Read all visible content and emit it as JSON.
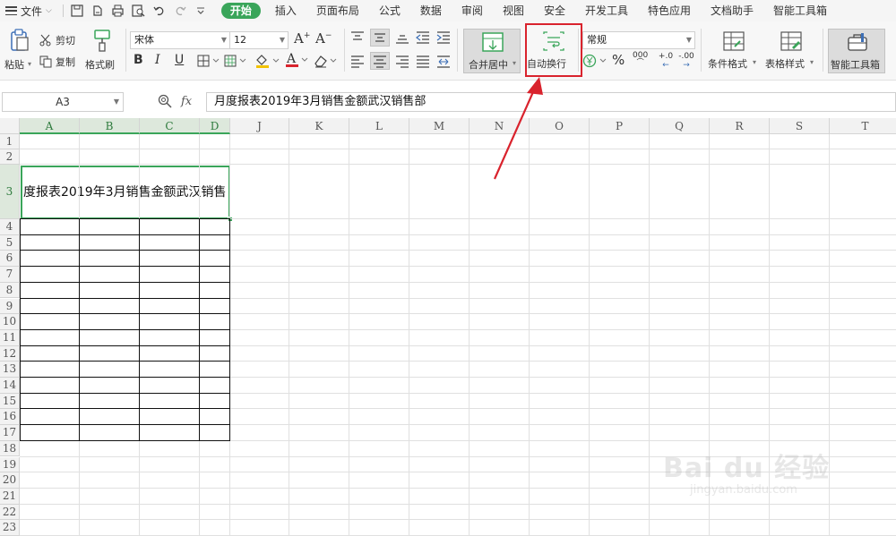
{
  "menubar": {
    "file_label": "文件",
    "tabs": [
      {
        "label": "开始",
        "active": true
      },
      {
        "label": "插入"
      },
      {
        "label": "页面布局"
      },
      {
        "label": "公式"
      },
      {
        "label": "数据"
      },
      {
        "label": "审阅"
      },
      {
        "label": "视图"
      },
      {
        "label": "安全"
      },
      {
        "label": "开发工具"
      },
      {
        "label": "特色应用"
      },
      {
        "label": "文档助手"
      },
      {
        "label": "智能工具箱"
      }
    ]
  },
  "ribbon": {
    "paste_label": "粘贴",
    "cut_label": "剪切",
    "copy_label": "复制",
    "format_painter_label": "格式刷",
    "font_name": "宋体",
    "font_size": "12",
    "merge_center_label": "合并居中",
    "wrap_text_label": "自动换行",
    "number_format": "常规",
    "percent_symbol": "%",
    "thousands_symbol": "000",
    "increase_decimal_label": "+.0",
    "decrease_decimal_label": "-.00",
    "conditional_format_label": "条件格式",
    "table_style_label": "表格样式",
    "smart_toolbox_label": "智能工具箱"
  },
  "formula_bar": {
    "name_box": "A3",
    "fx_label": "fx",
    "content": "月度报表2019年3月销售金额武汉销售部"
  },
  "sheet": {
    "columns": [
      "A",
      "B",
      "C",
      "D",
      "J",
      "K",
      "L",
      "M",
      "N",
      "O",
      "P",
      "Q",
      "R",
      "S",
      "T"
    ],
    "rows": [
      "1",
      "2",
      "3",
      "4",
      "5",
      "6",
      "7",
      "8",
      "9",
      "10",
      "11",
      "12",
      "13",
      "14",
      "15",
      "16",
      "17",
      "18",
      "19",
      "20",
      "21",
      "22",
      "23"
    ],
    "a3_display": "度报表2019年3月销售金额武汉销售"
  },
  "watermark": {
    "main": "Bai du 经验",
    "sub": "jingyan.baidu.com"
  },
  "colors": {
    "accent_green": "#3aa55a",
    "highlight_red": "#d9232d"
  }
}
